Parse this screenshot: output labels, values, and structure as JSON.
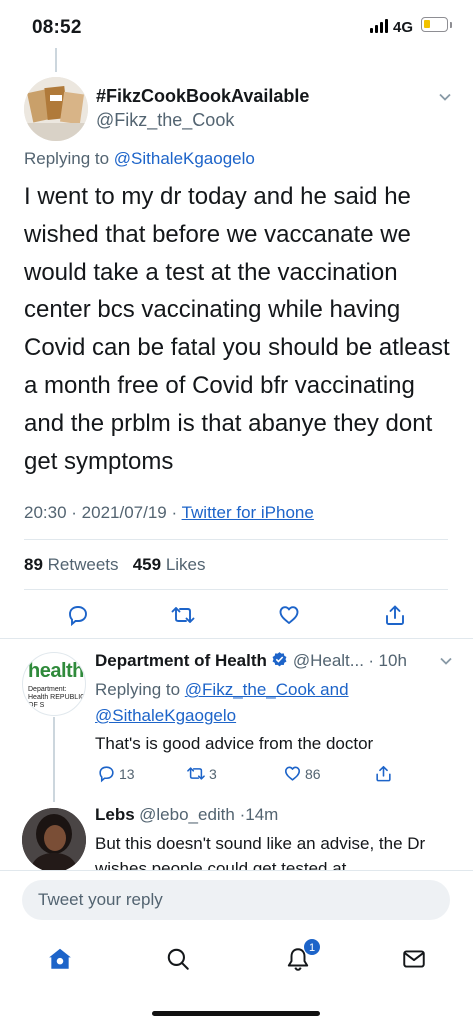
{
  "status_bar": {
    "time": "08:52",
    "network": "4G"
  },
  "main_tweet": {
    "display_name": "#FikzCookBookAvailable",
    "handle": "@Fikz_the_Cook",
    "avatar_icon": "cookbook-avatar",
    "replying_prefix": "Replying to ",
    "replying_to": "@SithaleKgaogelo",
    "text": "I went to my dr today and he said he wished that before we vaccanate we would take a test at the vaccination center bcs vaccinating while having Covid can be fatal you should be atleast a month free of Covid bfr vaccinating and the prblm is that abanye they dont get symptoms",
    "time": "20:30",
    "date": "2021/07/19",
    "source": "Twitter for iPhone",
    "retweets_count": "89",
    "retweets_label": "Retweets",
    "likes_count": "459",
    "likes_label": "Likes",
    "actions": [
      "reply-icon",
      "retweet-icon",
      "like-icon",
      "share-icon"
    ]
  },
  "replies": [
    {
      "display_name": "Department of Health",
      "verified": true,
      "handle": "@Healt...",
      "time": "10h",
      "avatar_text": "health",
      "avatar_subtext": "Department: Health REPUBLIC OF S",
      "replying_prefix": "Replying to ",
      "replying_to_1": "@Fikz_the_Cook",
      "replying_and": " and",
      "replying_to_2": "@SithaleKgaogelo",
      "text": "That's is good advice from the doctor",
      "reply_count": "13",
      "retweet_count": "3",
      "like_count": "86"
    },
    {
      "display_name": "Lebs",
      "handle": "@lebo_edith",
      "time": "14m",
      "text": "But this doesn't sound like an advise, the Dr wishes people could get tested at"
    }
  ],
  "reply_input": {
    "placeholder": "Tweet your reply"
  },
  "tabbar": {
    "items": [
      "home-icon",
      "search-icon",
      "notifications-icon",
      "messages-icon"
    ],
    "notification_count": "1"
  },
  "colors": {
    "accent": "#1d64c9",
    "text": "#14171a",
    "muted": "#536471",
    "divider": "#e1e8ed"
  }
}
